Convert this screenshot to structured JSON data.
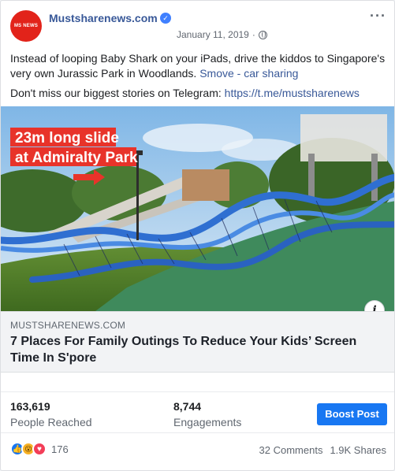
{
  "post": {
    "avatar_text": "MS NEWS",
    "page_name": "Mustsharenews.com",
    "date": "January 11, 2019",
    "separator": "·",
    "text_line1_prefix": "Instead of looping Baby Shark on your iPads, drive the kiddos to Singapore's very own Jurassic Park in Woodlands.",
    "text_line1_link": "Smove - car sharing",
    "text_line2_prefix": "Don't miss our biggest stories on Telegram:",
    "text_line2_link": "https://t.me/mustsharenews",
    "image_overlay_line1": "23m long slide",
    "image_overlay_line2": "at Admiralty Park"
  },
  "preview": {
    "domain": "MUSTSHARENEWS.COM",
    "headline": "7 Places For Family Outings To Reduce Your Kids’ Screen Time In S'pore"
  },
  "stats": {
    "reached_value": "163,619",
    "reached_label": "People Reached",
    "engagements_value": "8,744",
    "engagements_label": "Engagements",
    "boost_label": "Boost Post"
  },
  "footer": {
    "reaction_count": "176",
    "comments": "32 Comments",
    "shares": "1.9K Shares"
  },
  "icons": {
    "verified": "verified-badge-icon",
    "globe": "globe-icon",
    "more": "more-options-icon",
    "info": "info-icon",
    "like": "like-reaction-icon",
    "wow": "wow-reaction-icon",
    "love": "love-reaction-icon"
  },
  "colors": {
    "link": "#385898",
    "boost": "#1877f2",
    "logo": "#e2231a",
    "overlay_red": "#e8332a"
  }
}
